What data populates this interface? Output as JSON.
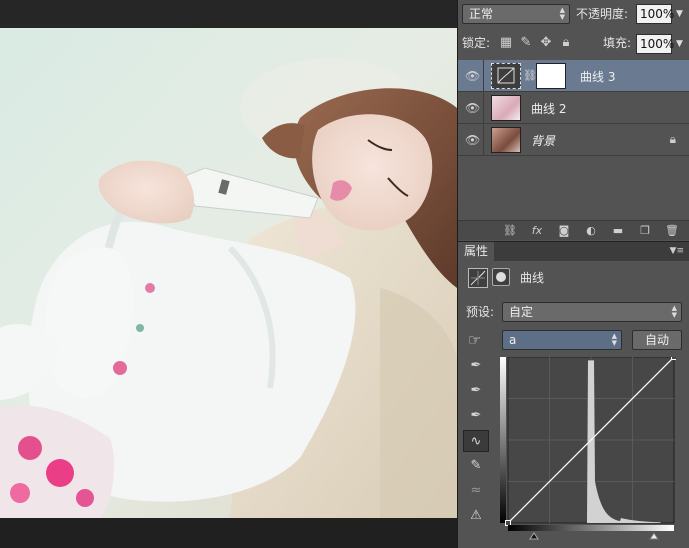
{
  "toolbar": {
    "blend_mode": "正常",
    "opacity_label": "不透明度:",
    "opacity_value": "100%",
    "lock_label": "锁定:",
    "fill_label": "填充:",
    "fill_value": "100%"
  },
  "layers": [
    {
      "name": "曲线 3",
      "selected": true,
      "has_mask": true,
      "thumb_icon": "curves-adjustment-icon"
    },
    {
      "name": "曲线 2",
      "selected": false,
      "has_mask": false,
      "thumb_icon": "photo-thumbnail"
    },
    {
      "name": "背景",
      "selected": false,
      "has_mask": false,
      "locked": true,
      "thumb_icon": "photo-thumbnail"
    }
  ],
  "properties": {
    "tab_label": "属性",
    "adjustment_name": "曲线",
    "preset_label": "预设:",
    "preset_value": "自定",
    "channel_value": "a",
    "auto_button": "自动"
  },
  "curve": {
    "channel": "a",
    "points": [
      [
        0,
        0
      ],
      [
        255,
        255
      ]
    ],
    "histogram_peak_at": 0.5
  },
  "colors": {
    "panel_bg": "#535353",
    "selected_layer": "#6a7a90",
    "graph_bg": "#474747",
    "curve_line": "#ffffff"
  }
}
